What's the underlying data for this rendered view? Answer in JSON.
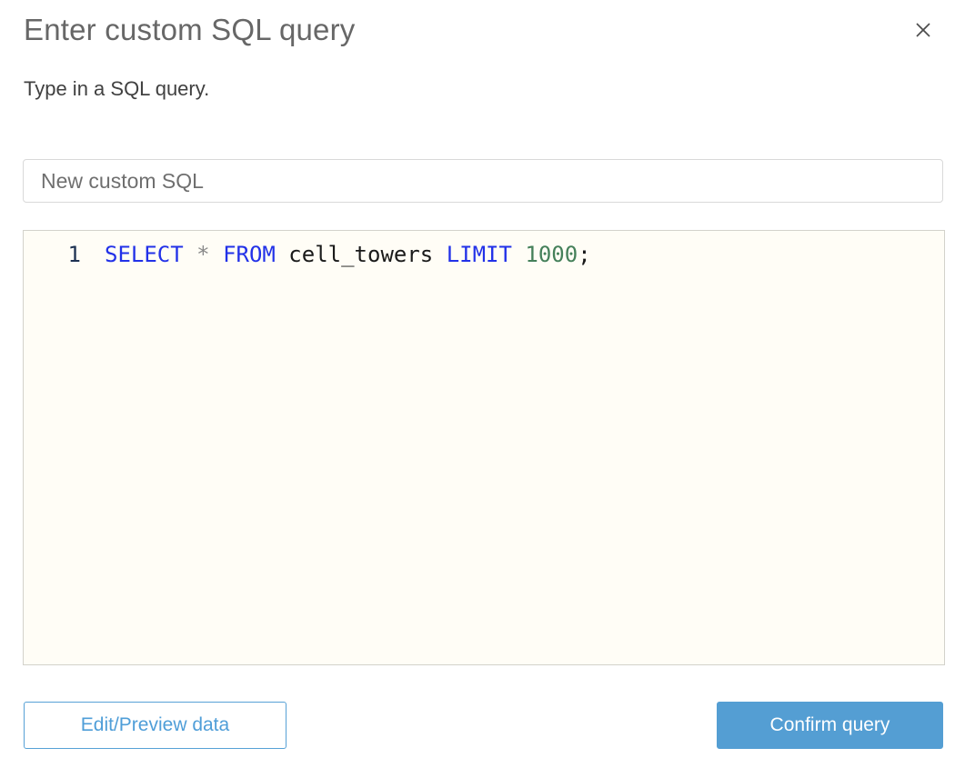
{
  "dialog": {
    "title": "Enter custom SQL query",
    "subtitle": "Type in a SQL query."
  },
  "name_input": {
    "value": "New custom SQL"
  },
  "editor": {
    "lines": [
      {
        "number": "1",
        "tokens": [
          {
            "type": "keyword",
            "text": "SELECT"
          },
          {
            "type": "plain",
            "text": " "
          },
          {
            "type": "operator",
            "text": "*"
          },
          {
            "type": "plain",
            "text": " "
          },
          {
            "type": "keyword",
            "text": "FROM"
          },
          {
            "type": "plain",
            "text": " cell_towers "
          },
          {
            "type": "keyword",
            "text": "LIMIT"
          },
          {
            "type": "plain",
            "text": " "
          },
          {
            "type": "number",
            "text": "1000"
          },
          {
            "type": "plain",
            "text": ";"
          }
        ]
      }
    ]
  },
  "buttons": {
    "edit_preview_label": "Edit/Preview data",
    "confirm_label": "Confirm query"
  },
  "colors": {
    "accent_blue": "#549ed3",
    "keyword_blue": "#2231e8",
    "number_green": "#45805a",
    "editor_background": "#fffdf6"
  }
}
